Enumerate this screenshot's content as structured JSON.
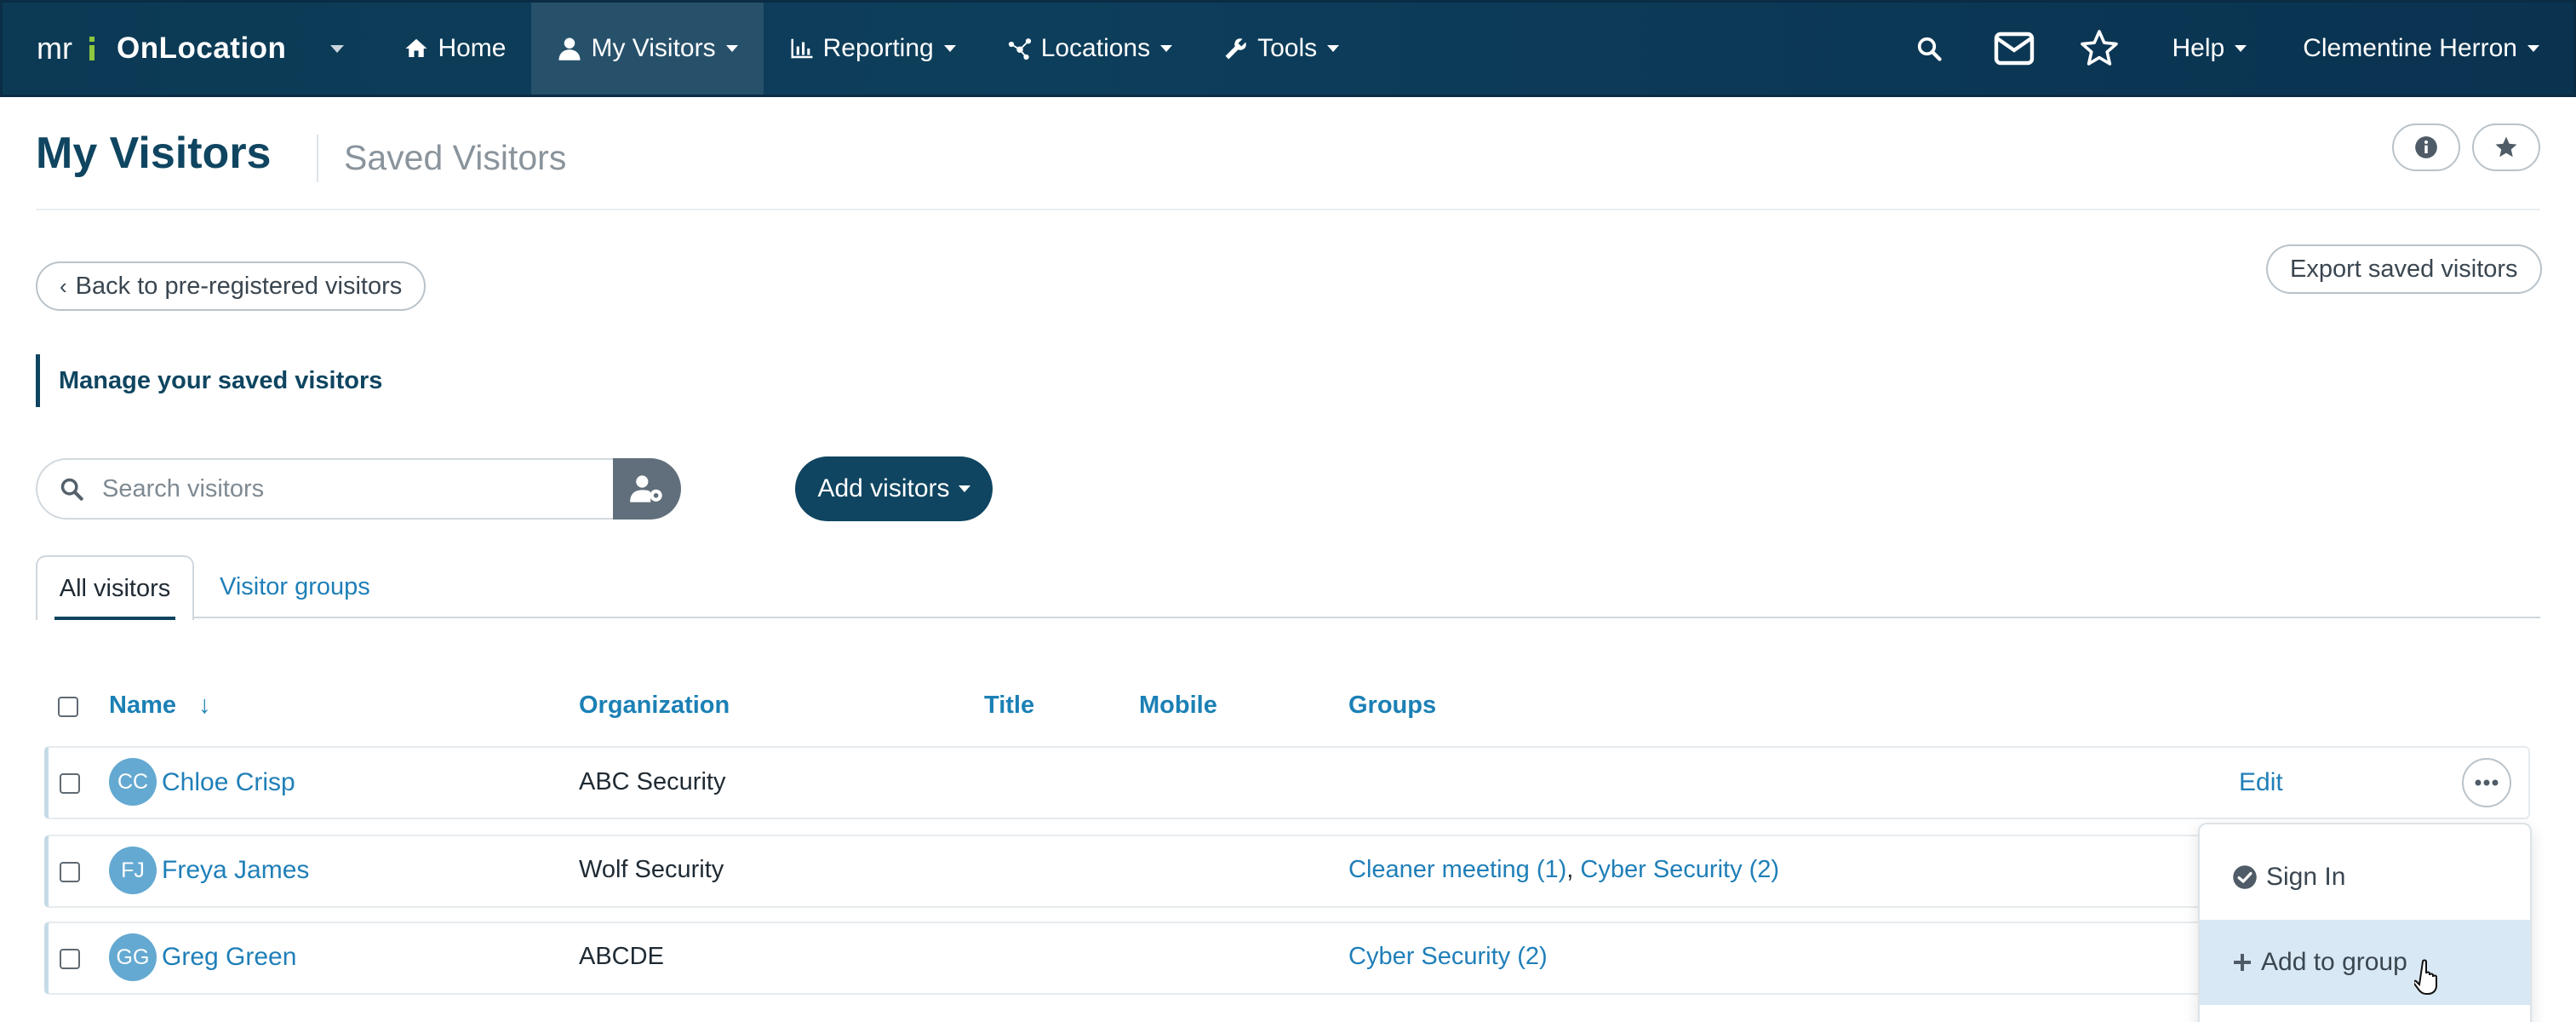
{
  "app": {
    "brand_mark": "mri",
    "brand_name": "OnLocation"
  },
  "nav": {
    "home": "Home",
    "my_visitors": "My Visitors",
    "reporting": "Reporting",
    "locations": "Locations",
    "tools": "Tools",
    "help": "Help",
    "user": "Clementine Herron",
    "icons": [
      "search-icon",
      "mail-icon",
      "star-icon"
    ]
  },
  "page": {
    "title": "My Visitors",
    "subtitle": "Saved Visitors",
    "back_button": "Back to pre-registered visitors",
    "export_button": "Export saved visitors",
    "manage_heading": "Manage your saved visitors"
  },
  "search": {
    "placeholder": "Search visitors"
  },
  "actions": {
    "add_visitors": "Add visitors"
  },
  "tabs": {
    "all": "All visitors",
    "groups": "Visitor groups"
  },
  "table": {
    "headers": {
      "name": "Name",
      "sort_indicator": "↓",
      "organization": "Organization",
      "title": "Title",
      "mobile": "Mobile",
      "groups": "Groups"
    },
    "rows": [
      {
        "initials": "CC",
        "name": "Chloe Crisp",
        "organization": "ABC Security",
        "groups": [],
        "edit": "Edit"
      },
      {
        "initials": "FJ",
        "name": "Freya James",
        "organization": "Wolf Security",
        "groups": [
          "Cleaner meeting (1)",
          "Cyber Security (2)"
        ],
        "group_separator": ", "
      },
      {
        "initials": "GG",
        "name": "Greg Green",
        "organization": "ABCDE",
        "groups": [
          "Cyber Security (2)"
        ]
      }
    ]
  },
  "row_menu": {
    "sign_in": "Sign In",
    "add_to_group": "Add to group"
  },
  "colors": {
    "nav_bg": "#0d3e5b",
    "nav_active": "#27516b",
    "primary": "#0f4560",
    "link": "#1f7fb8",
    "avatar": "#64a9d1",
    "menu_hover": "#d8e8f4"
  }
}
